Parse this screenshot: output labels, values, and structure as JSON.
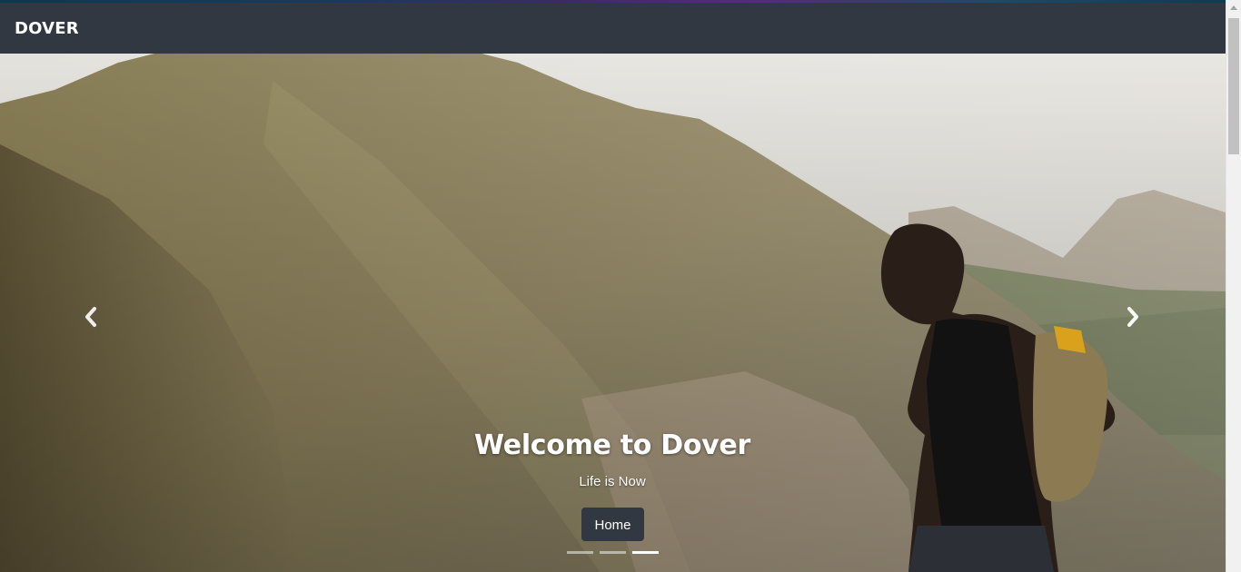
{
  "navbar": {
    "brand": "DOVER"
  },
  "carousel": {
    "prev_icon": "chevron-left-icon",
    "next_icon": "chevron-right-icon",
    "slide": {
      "title": "Welcome to Dover",
      "subtitle": "Life is Now",
      "button_label": "Home"
    },
    "indicators": [
      {
        "active": false
      },
      {
        "active": false
      },
      {
        "active": true
      }
    ]
  },
  "colors": {
    "navbar_bg": "#323841",
    "button_bg": "#323841",
    "text": "#ffffff"
  }
}
